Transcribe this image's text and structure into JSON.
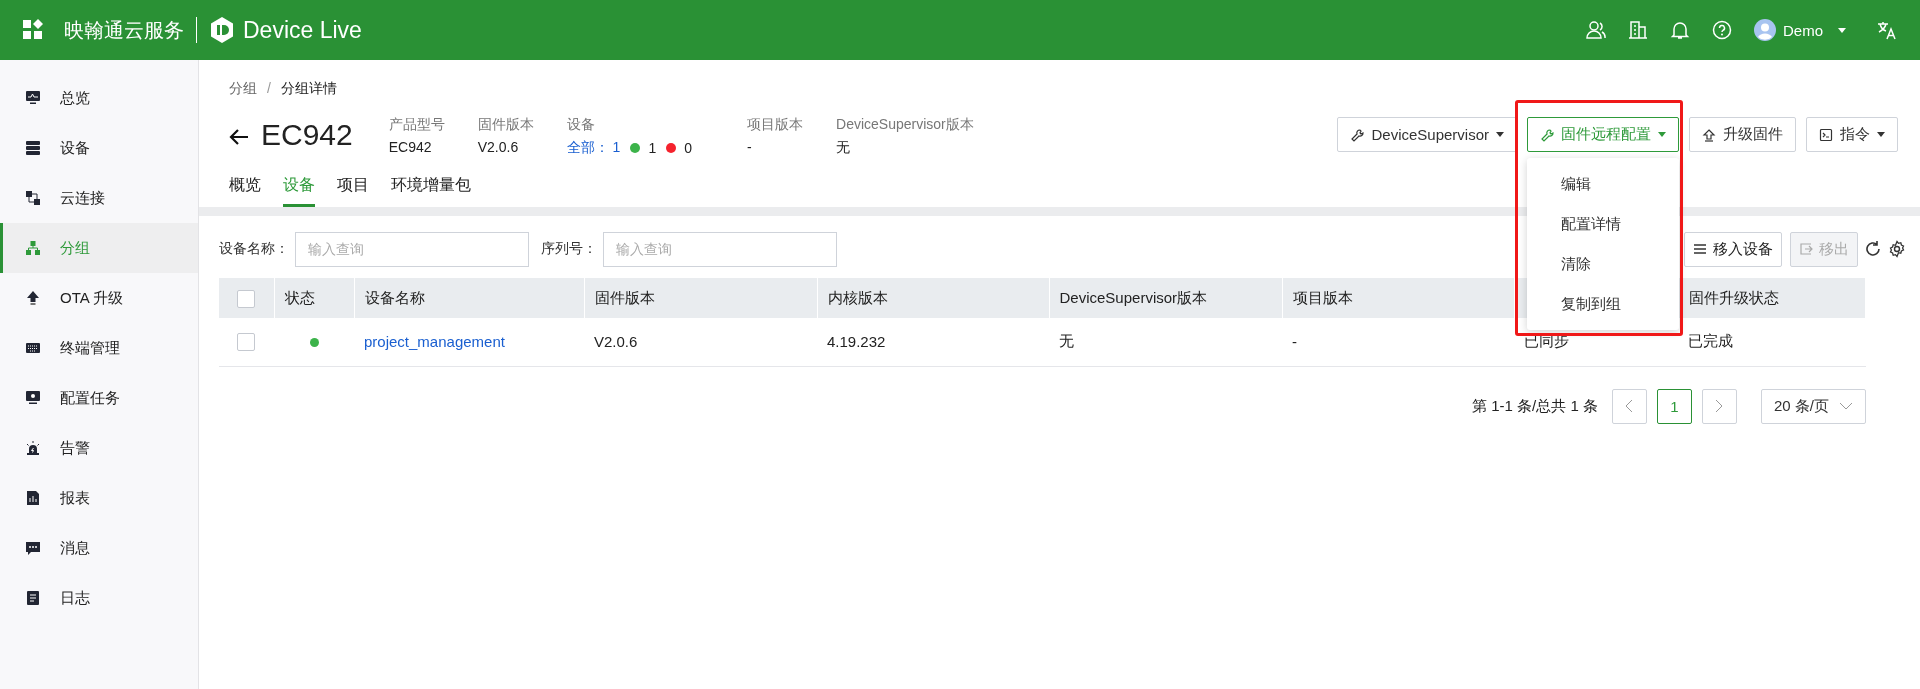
{
  "header": {
    "brand": "映翰通云服务",
    "product": "Device Live",
    "user": "Demo"
  },
  "sidebar": {
    "items": [
      {
        "label": "总览",
        "kind": "monitor",
        "selected": false
      },
      {
        "label": "设备",
        "kind": "server",
        "selected": false
      },
      {
        "label": "云连接",
        "kind": "link",
        "selected": false
      },
      {
        "label": "分组",
        "kind": "group",
        "selected": true
      },
      {
        "label": "OTA 升级",
        "kind": "upload",
        "selected": false
      },
      {
        "label": "终端管理",
        "kind": "keyboard",
        "selected": false
      },
      {
        "label": "配置任务",
        "kind": "task",
        "selected": false
      },
      {
        "label": "告警",
        "kind": "alarm",
        "selected": false
      },
      {
        "label": "报表",
        "kind": "report",
        "selected": false
      },
      {
        "label": "消息",
        "kind": "message",
        "selected": false
      },
      {
        "label": "日志",
        "kind": "log",
        "selected": false
      }
    ]
  },
  "breadcrumb": {
    "items": [
      "分组",
      "分组详情"
    ],
    "separator": "/"
  },
  "title": "EC942",
  "info": [
    {
      "kind": "text",
      "label": "产品型号",
      "value": "EC942"
    },
    {
      "kind": "text",
      "label": "固件版本",
      "value": "V2.0.6"
    },
    {
      "kind": "counts",
      "label": "设备",
      "link": "全部：",
      "value": "1",
      "counts": [
        {
          "value": "1",
          "color": "#3cb34a"
        },
        {
          "value": "0",
          "color": "#f5222d"
        }
      ]
    },
    {
      "kind": "text",
      "label": "项目版本",
      "value": "-"
    },
    {
      "kind": "text",
      "label": "DeviceSupervisor版本",
      "value": "无"
    }
  ],
  "actions": [
    {
      "label": "DeviceSupervisor",
      "kind": "wrench",
      "caret": true,
      "open": false
    },
    {
      "label": "固件远程配置",
      "kind": "wrench",
      "caret": true,
      "open": true
    },
    {
      "label": "升级固件",
      "kind": "upload",
      "caret": false,
      "open": false
    },
    {
      "label": "指令",
      "kind": "terminal",
      "caret": true,
      "open": false
    }
  ],
  "dropdown": {
    "items": [
      "编辑",
      "配置详情",
      "清除",
      "复制到组"
    ],
    "highlighted": true
  },
  "tabs": [
    {
      "label": "概览",
      "selected": false
    },
    {
      "label": "设备",
      "selected": true
    },
    {
      "label": "项目",
      "selected": false
    },
    {
      "label": "环境增量包",
      "selected": false
    }
  ],
  "filters": [
    {
      "label": "设备名称：",
      "placeholder": "输入查询"
    },
    {
      "label": "序列号：",
      "placeholder": "输入查询"
    }
  ],
  "toolbar": {
    "move_in": {
      "label": "移入设备",
      "disabled": false
    },
    "move_out": {
      "label": "移出",
      "disabled": true
    }
  },
  "table": {
    "all_checked": false,
    "status_column": "状态",
    "columns": [
      {
        "label": "设备名称"
      },
      {
        "label": "固件版本"
      },
      {
        "label": "内核版本"
      },
      {
        "label": "DeviceSupervisor版本"
      },
      {
        "label": "项目版本"
      },
      {},
      {
        "label": "固件升级状态"
      }
    ],
    "rows": [
      {
        "checked": false,
        "online": true,
        "cells": [
          "project_management",
          "V2.0.6",
          "4.19.232",
          "无",
          "-",
          "已同步",
          "已完成"
        ]
      }
    ]
  },
  "pagination": {
    "summary": "第 1-1 条/总共 1 条",
    "pages": [
      {
        "label": "1",
        "selected": true
      }
    ],
    "page_size": "20 条/页"
  }
}
